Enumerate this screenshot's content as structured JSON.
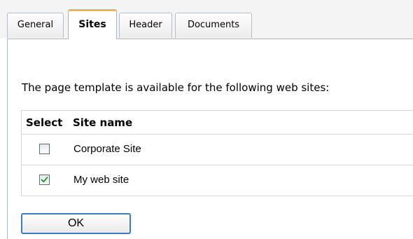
{
  "tabs": [
    {
      "label": "General",
      "active": false
    },
    {
      "label": "Sites",
      "active": true
    },
    {
      "label": "Header",
      "active": false
    },
    {
      "label": "Documents",
      "active": false
    }
  ],
  "intro_text": "The page template is available for the following web sites:",
  "grid": {
    "columns": [
      "Select",
      "Site name"
    ],
    "rows": [
      {
        "site_name": "Corporate Site",
        "selected": false
      },
      {
        "site_name": "My web site",
        "selected": true
      }
    ]
  },
  "ok_label": "OK",
  "colors": {
    "active_tab_accent": "#f0b64a",
    "check_mark": "#2e9e2e",
    "button_border": "#3e7bbf"
  }
}
